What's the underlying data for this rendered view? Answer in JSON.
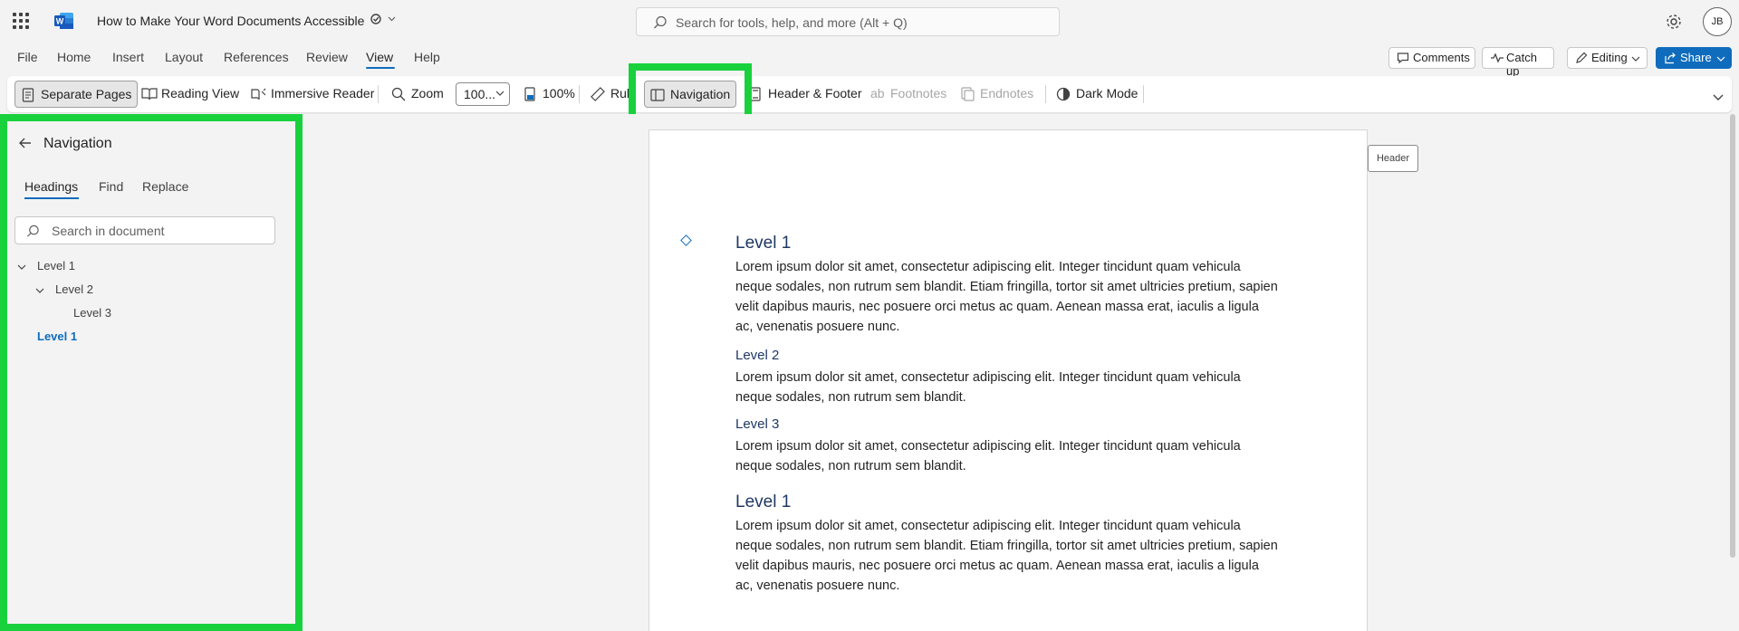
{
  "titlebar": {
    "doc_title": "How to Make Your Word Documents Accessible",
    "search_placeholder": "Search for tools, help, and more (Alt + Q)",
    "avatar_initials": "JB"
  },
  "menu": {
    "items": [
      "File",
      "Home",
      "Insert",
      "Layout",
      "References",
      "Review",
      "View",
      "Help"
    ],
    "active": "View",
    "comments": "Comments",
    "catch_up": "Catch up",
    "editing": "Editing",
    "share": "Share"
  },
  "ribbon": {
    "separate_pages": "Separate Pages",
    "reading_view": "Reading View",
    "immersive_reader": "Immersive Reader",
    "zoom": "Zoom",
    "zoom_value": "100...",
    "hundred": "100%",
    "ruler": "Rul",
    "navigation": "Navigation",
    "header_footer": "Header & Footer",
    "footnotes": "Footnotes",
    "endnotes": "Endnotes",
    "dark_mode": "Dark Mode"
  },
  "nav": {
    "title": "Navigation",
    "tabs": [
      "Headings",
      "Find",
      "Replace"
    ],
    "search_placeholder": "Search in document",
    "tree": [
      "Level 1",
      "Level 2",
      "Level 3",
      "Level 1"
    ]
  },
  "doc": {
    "header_tag": "Header",
    "h1a": "Level 1",
    "p1": "Lorem ipsum dolor sit amet, consectetur adipiscing elit. Integer tincidunt quam vehicula neque sodales, non rutrum sem blandit. Etiam fringilla, tortor sit amet ultricies pretium, sapien velit dapibus mauris, nec posuere orci metus ac quam. Aenean massa erat, iaculis a ligula ac, venenatis posuere nunc.",
    "h2": "Level 2",
    "p2": "Lorem ipsum dolor sit amet, consectetur adipiscing elit. Integer tincidunt quam vehicula neque sodales, non rutrum sem blandit.",
    "h3": "Level 3",
    "p3": "Lorem ipsum dolor sit amet, consectetur adipiscing elit. Integer tincidunt quam vehicula neque sodales, non rutrum sem blandit.",
    "h1b": "Level 1",
    "p4": "Lorem ipsum dolor sit amet, consectetur adipiscing elit. Integer tincidunt quam vehicula neque sodales, non rutrum sem blandit. Etiam fringilla, tortor sit amet ultricies pretium, sapien velit dapibus mauris, nec posuere orci metus ac quam. Aenean massa erat, iaculis a ligula ac, venenatis posuere nunc."
  },
  "colors": {
    "accent": "#0f6cbd",
    "highlight": "#19d13d",
    "heading": "#1f3864"
  }
}
